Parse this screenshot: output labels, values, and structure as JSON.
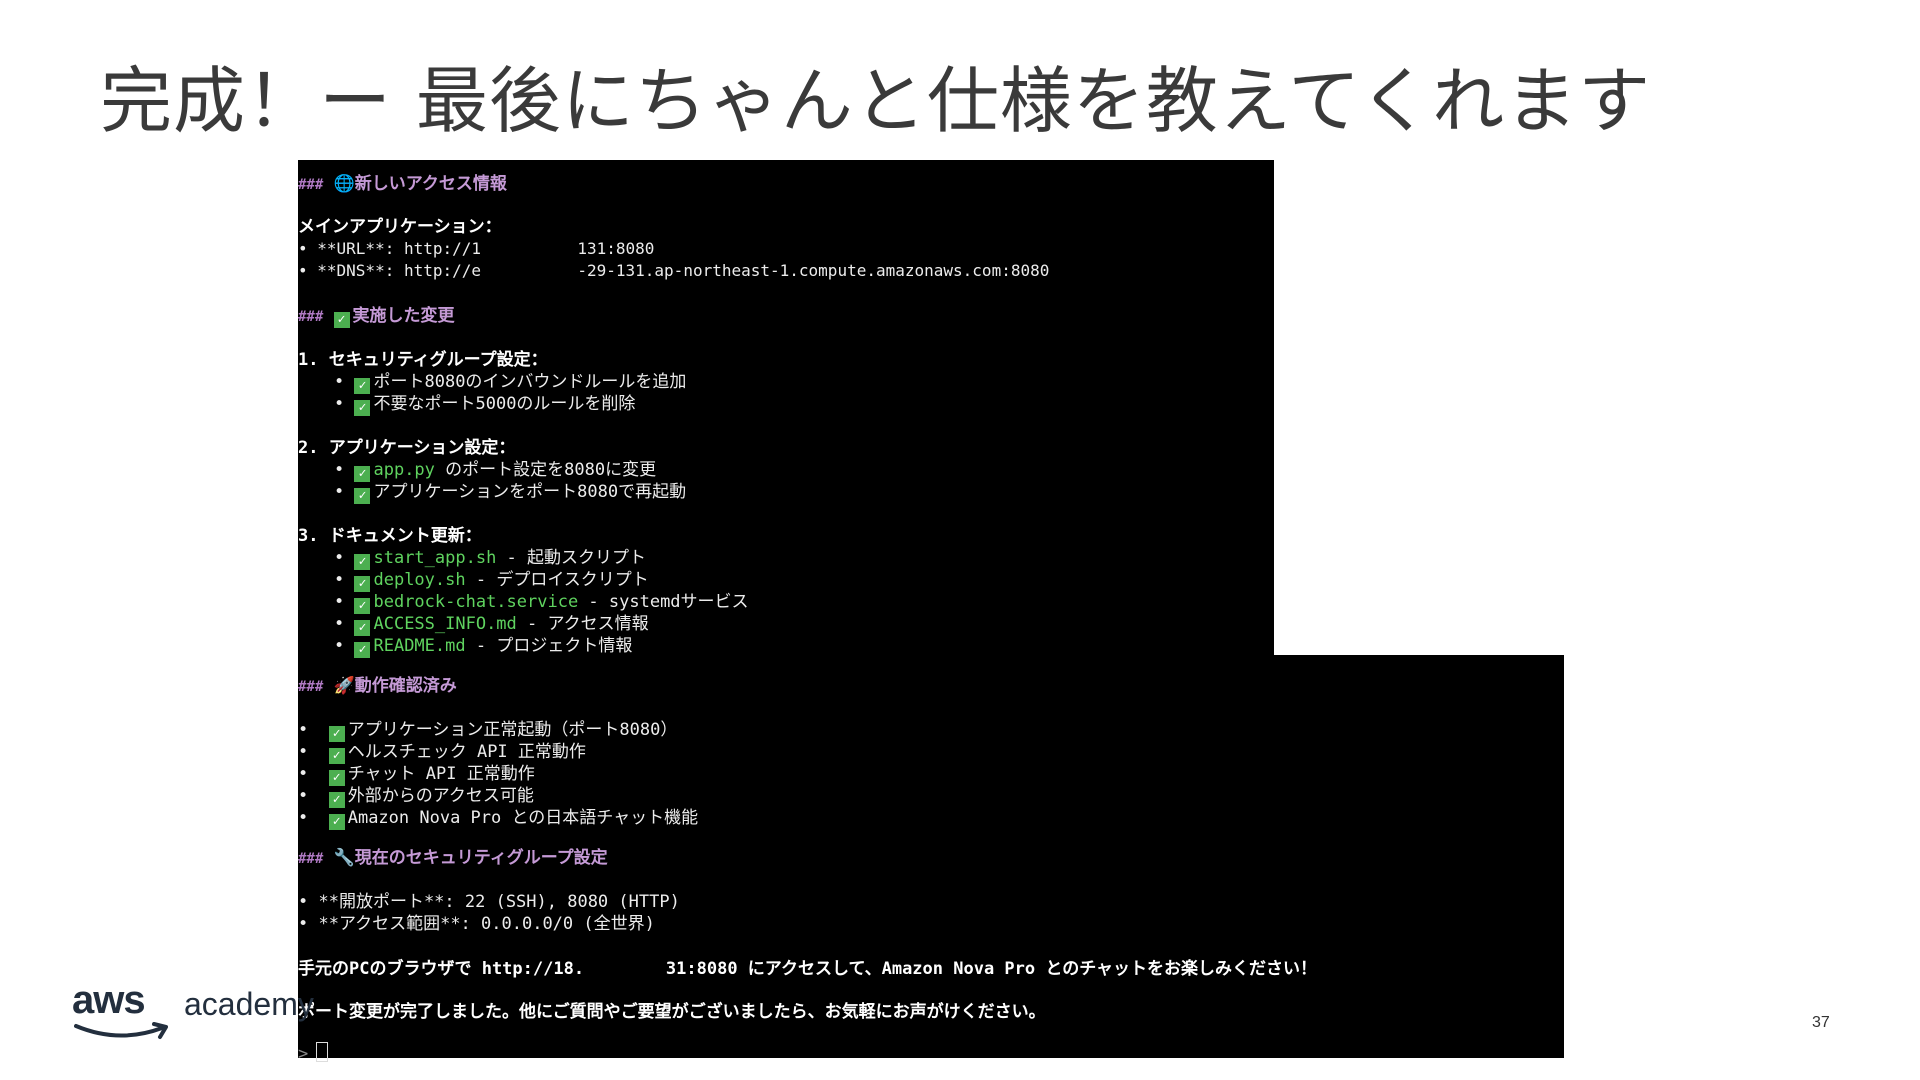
{
  "slide": {
    "title": "完成！ー 最後にちゃんと仕様を教えてくれます",
    "page_number": "37",
    "logo_text_aws": "aws",
    "logo_text_academy": "academy"
  },
  "terminal": {
    "section1": {
      "hash": "###",
      "icon": "globe-icon",
      "title": "新しいアクセス情報"
    },
    "main_app_label": "メインアプリケーション：",
    "url_line": "• **URL**: http://1          131:8080",
    "dns_line": "• **DNS**: http://e          -29-131.ap-northeast-1.compute.amazonaws.com:8080",
    "section2": {
      "hash": "###",
      "icon": "check-icon",
      "title": "実施した変更"
    },
    "group1": {
      "heading": "1. セキュリティグループ設定：",
      "items": [
        "ポート8080のインバウンドルールを追加",
        "不要なポート5000のルールを削除"
      ]
    },
    "group2": {
      "heading": "2. アプリケーション設定：",
      "items": [
        {
          "file": "app.py",
          "text": " のポート設定を8080に変更"
        },
        {
          "file": "",
          "text": "アプリケーションをポート8080で再起動"
        }
      ]
    },
    "group3": {
      "heading": "3. ドキュメント更新：",
      "items": [
        {
          "file": "start_app.sh",
          "text": " - 起動スクリプト"
        },
        {
          "file": "deploy.sh",
          "text": " - デプロイスクリプト"
        },
        {
          "file": "bedrock-chat.service",
          "text": " - systemdサービス"
        },
        {
          "file": "ACCESS_INFO.md",
          "text": " - アクセス情報"
        },
        {
          "file": "README.md",
          "text": " - プロジェクト情報"
        }
      ]
    },
    "section3": {
      "hash": "###",
      "icon": "rocket-icon",
      "title": "動作確認済み"
    },
    "verified": [
      "アプリケーション正常起動（ポート8080）",
      "ヘルスチェック API 正常動作",
      "チャット API 正常動作",
      "外部からのアクセス可能",
      "Amazon Nova Pro との日本語チャット機能"
    ],
    "section4": {
      "hash": "###",
      "icon": "wrench-icon",
      "title": "現在のセキュリティグループ設定"
    },
    "sg_lines": [
      "• **開放ポート**: 22 (SSH), 8080 (HTTP)",
      "• **アクセス範囲**: 0.0.0.0/0 (全世界)"
    ],
    "closing1": "手元のPCのブラウザで http://18.        31:8080 にアクセスして、Amazon Nova Pro とのチャットをお楽しみください！",
    "closing2": "ポート変更が完了しました。他にご質問やご要望がございましたら、お気軽にお声がけください。",
    "prompt": ">"
  }
}
